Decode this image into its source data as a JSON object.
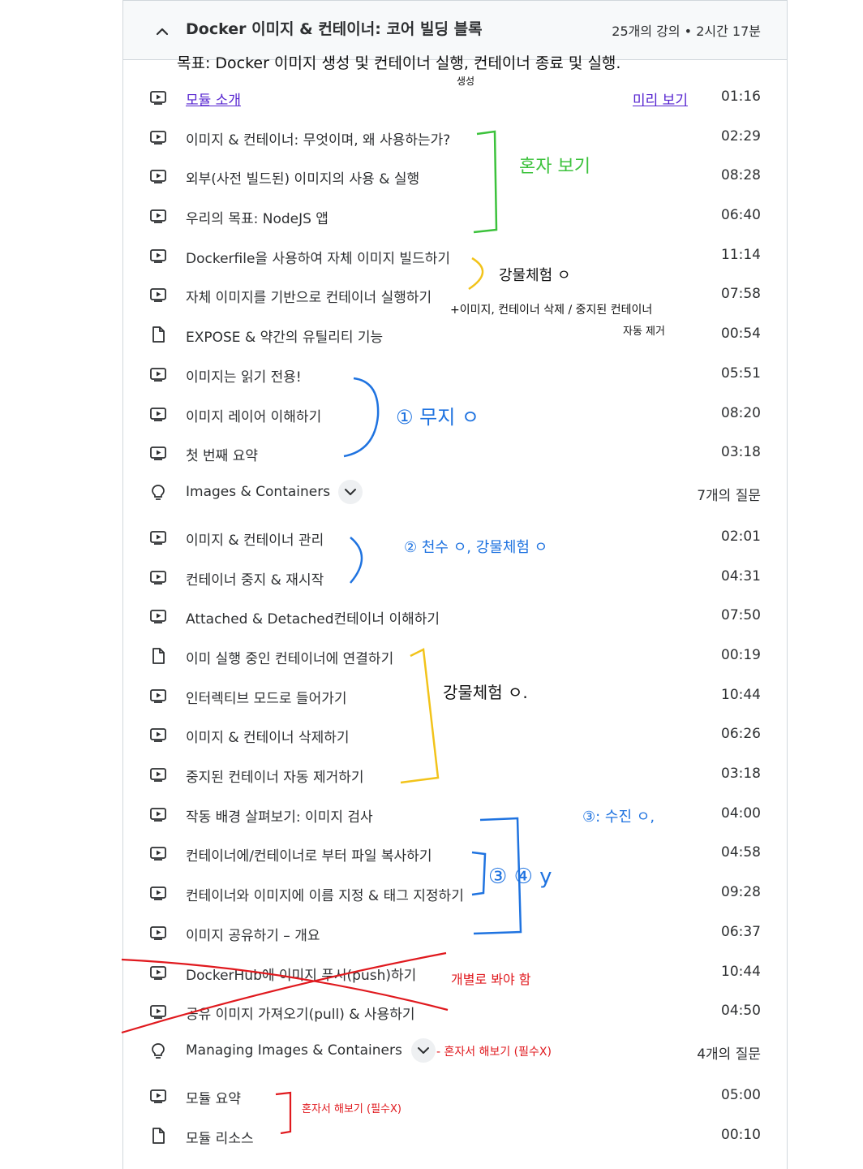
{
  "section": {
    "title": "Docker 이미지 & 컨테이너: 코어 빌딩 블록",
    "meta": "25개의 강의 • 2시간 17분"
  },
  "rows": [
    {
      "title": "모듈 소개",
      "duration": "01:16",
      "preview": "미리 보기"
    },
    {
      "title": "이미지 & 컨테이너: 무엇이며, 왜 사용하는가?",
      "duration": "02:29"
    },
    {
      "title": "외부(사전 빌드된) 이미지의 사용 & 실행",
      "duration": "08:28"
    },
    {
      "title": "우리의 목표: NodeJS 앱",
      "duration": "06:40"
    },
    {
      "title": "Dockerfile을 사용하여 자체 이미지 빌드하기",
      "duration": "11:14"
    },
    {
      "title": "자체 이미지를 기반으로 컨테이너 실행하기",
      "duration": "07:58"
    },
    {
      "title": "EXPOSE & 약간의 유틸리티 기능",
      "duration": "00:54"
    },
    {
      "title": "이미지는 읽기 전용!",
      "duration": "05:51"
    },
    {
      "title": "이미지 레이어 이해하기",
      "duration": "08:20"
    },
    {
      "title": "첫 번째 요약",
      "duration": "03:18"
    },
    {
      "title": "Images & Containers",
      "duration": "7개의 질문"
    },
    {
      "title": "이미지 & 컨테이너 관리",
      "duration": "02:01"
    },
    {
      "title": "컨테이너 중지 & 재시작",
      "duration": "04:31"
    },
    {
      "title": "Attached & Detached컨테이너 이해하기",
      "duration": "07:50"
    },
    {
      "title": "이미 실행 중인 컨테이너에 연결하기",
      "duration": "00:19"
    },
    {
      "title": "인터렉티브 모드로 들어가기",
      "duration": "10:44"
    },
    {
      "title": "이미지 & 컨테이너 삭제하기",
      "duration": "06:26"
    },
    {
      "title": "중지된 컨테이너 자동 제거하기",
      "duration": "03:18"
    },
    {
      "title": "작동 배경 살펴보기: 이미지 검사",
      "duration": "04:00"
    },
    {
      "title": "컨테이너에/컨테이너로 부터 파일 복사하기",
      "duration": "04:58"
    },
    {
      "title": "컨테이너와 이미지에 이름 지정 & 태그 지정하기",
      "duration": "09:28"
    },
    {
      "title": "이미지 공유하기 – 개요",
      "duration": "06:37"
    },
    {
      "title": "DockerHub에 이미지 푸시(push)하기",
      "duration": "10:44"
    },
    {
      "title": "공유 이미지 가져오기(pull) & 사용하기",
      "duration": "04:50"
    },
    {
      "title": "Managing Images & Containers",
      "duration": "4개의 질문"
    },
    {
      "title": "모듈 요약",
      "duration": "05:00"
    },
    {
      "title": "모듈 리소스",
      "duration": "00:10"
    }
  ],
  "annotations": {
    "goal": "목표: Docker 이미지 생성 및 컨테이너 실행, 컨테이너 종료 및 실행.",
    "goal_sub": "생성",
    "solo": "혼자 보기",
    "lecture_done": "강물체험 ㅇ",
    "delete_note": "+이미지, 컨테이너 삭제 / 중지된 컨테이너",
    "delete_note2": "자동 제거",
    "memo1": "① 무지 ㅇ",
    "memo2": "② 천수 ㅇ, 강물체험 ㅇ",
    "lecture_done2": "강물체험 ㅇ.",
    "memo3": "③: 수진 ㅇ,",
    "memo3b": "③ ④ y",
    "must_watch": "개별로 봐야 함",
    "quiz_note": "- 혼자서 해보기 (필수X)",
    "summary_note": "혼자서 해보기 (필수X)"
  }
}
